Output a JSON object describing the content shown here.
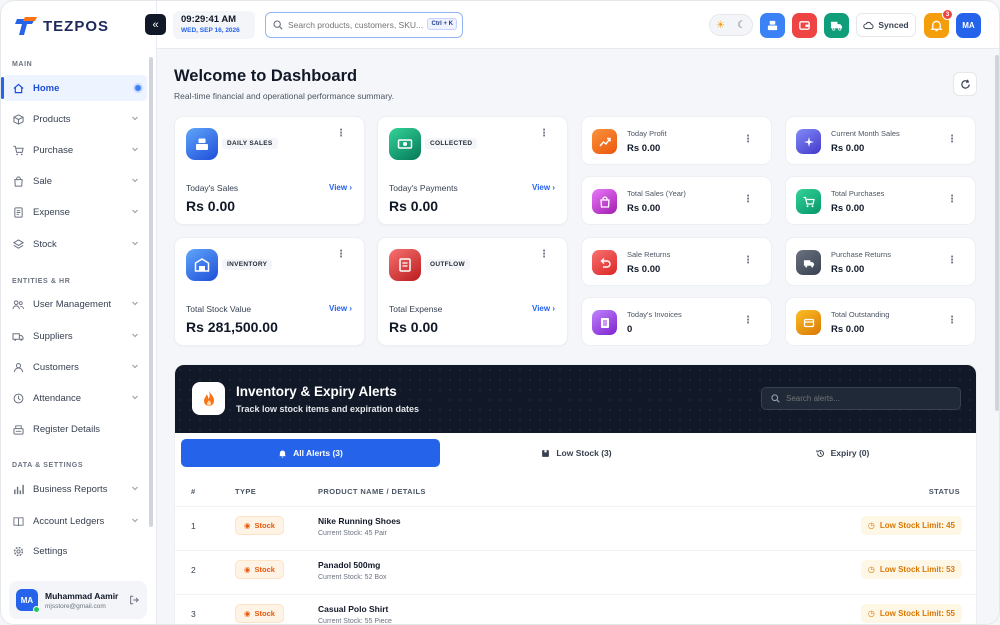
{
  "app": {
    "logo_text": "TEZPOS"
  },
  "sidebar": {
    "sections": [
      "MAIN",
      "ENTITIES & HR",
      "DATA & SETTINGS"
    ],
    "items": [
      {
        "label": "Home"
      },
      {
        "label": "Products"
      },
      {
        "label": "Purchase"
      },
      {
        "label": "Sale"
      },
      {
        "label": "Expense"
      },
      {
        "label": "Stock"
      },
      {
        "label": "User Management"
      },
      {
        "label": "Suppliers"
      },
      {
        "label": "Customers"
      },
      {
        "label": "Attendance"
      },
      {
        "label": "Register Details"
      },
      {
        "label": "Business Reports"
      },
      {
        "label": "Account Ledgers"
      },
      {
        "label": "Settings"
      }
    ],
    "user": {
      "initials": "MA",
      "name": "Muhammad Aamir",
      "email": "mjsstore@gmail.com"
    }
  },
  "topbar": {
    "time": "09:29:41 AM",
    "date": "WED, SEP 16, 2026",
    "search_placeholder": "Search products, customers, SKU...",
    "shortcut": "Ctrl + K",
    "synced_label": "Synced",
    "notification_count": "3",
    "avatar_initials": "MA"
  },
  "header": {
    "title": "Welcome to Dashboard",
    "subtitle": "Real-time financial and operational performance summary."
  },
  "big_cards": [
    {
      "tag": "DAILY SALES",
      "label": "Today's Sales",
      "value": "Rs 0.00",
      "link": "View"
    },
    {
      "tag": "COLLECTED",
      "label": "Today's Payments",
      "value": "Rs 0.00",
      "link": "View"
    },
    {
      "tag": "INVENTORY",
      "label": "Total Stock Value",
      "value": "Rs 281,500.00",
      "link": "View"
    },
    {
      "tag": "OUTFLOW",
      "label": "Total Expense",
      "value": "Rs 0.00",
      "link": "View"
    }
  ],
  "small_cards": [
    {
      "label": "Today Profit",
      "value": "Rs 0.00"
    },
    {
      "label": "Current Month Sales",
      "value": "Rs 0.00"
    },
    {
      "label": "Total Sales (Year)",
      "value": "Rs 0.00"
    },
    {
      "label": "Total Purchases",
      "value": "Rs 0.00"
    },
    {
      "label": "Sale Returns",
      "value": "Rs 0.00"
    },
    {
      "label": "Purchase Returns",
      "value": "Rs 0.00"
    },
    {
      "label": "Today's Invoices",
      "value": "0"
    },
    {
      "label": "Total Outstanding",
      "value": "Rs 0.00"
    }
  ],
  "alerts": {
    "title": "Inventory & Expiry Alerts",
    "subtitle": "Track low stock items and expiration dates",
    "search_placeholder": "Search alerts...",
    "tabs": [
      {
        "label": "All Alerts (3)"
      },
      {
        "label": "Low Stock (3)"
      },
      {
        "label": "Expiry (0)"
      }
    ],
    "columns": {
      "num": "#",
      "type": "TYPE",
      "product": "PRODUCT NAME / DETAILS",
      "status": "STATUS"
    },
    "rows": [
      {
        "num": "1",
        "type": "Stock",
        "name": "Nike Running Shoes",
        "detail": "Current Stock: 45 Pair",
        "status": "Low Stock Limit: 45"
      },
      {
        "num": "2",
        "type": "Stock",
        "name": "Panadol 500mg",
        "detail": "Current Stock: 52 Box",
        "status": "Low Stock Limit: 53"
      },
      {
        "num": "3",
        "type": "Stock",
        "name": "Casual Polo Shirt",
        "detail": "Current Stock: 55 Piece",
        "status": "Low Stock Limit: 55"
      }
    ]
  },
  "colors": {
    "primary": "#2563eb",
    "dark_panel": "#111827",
    "warning": "#d97706",
    "stock_badge": "#ea580c"
  }
}
